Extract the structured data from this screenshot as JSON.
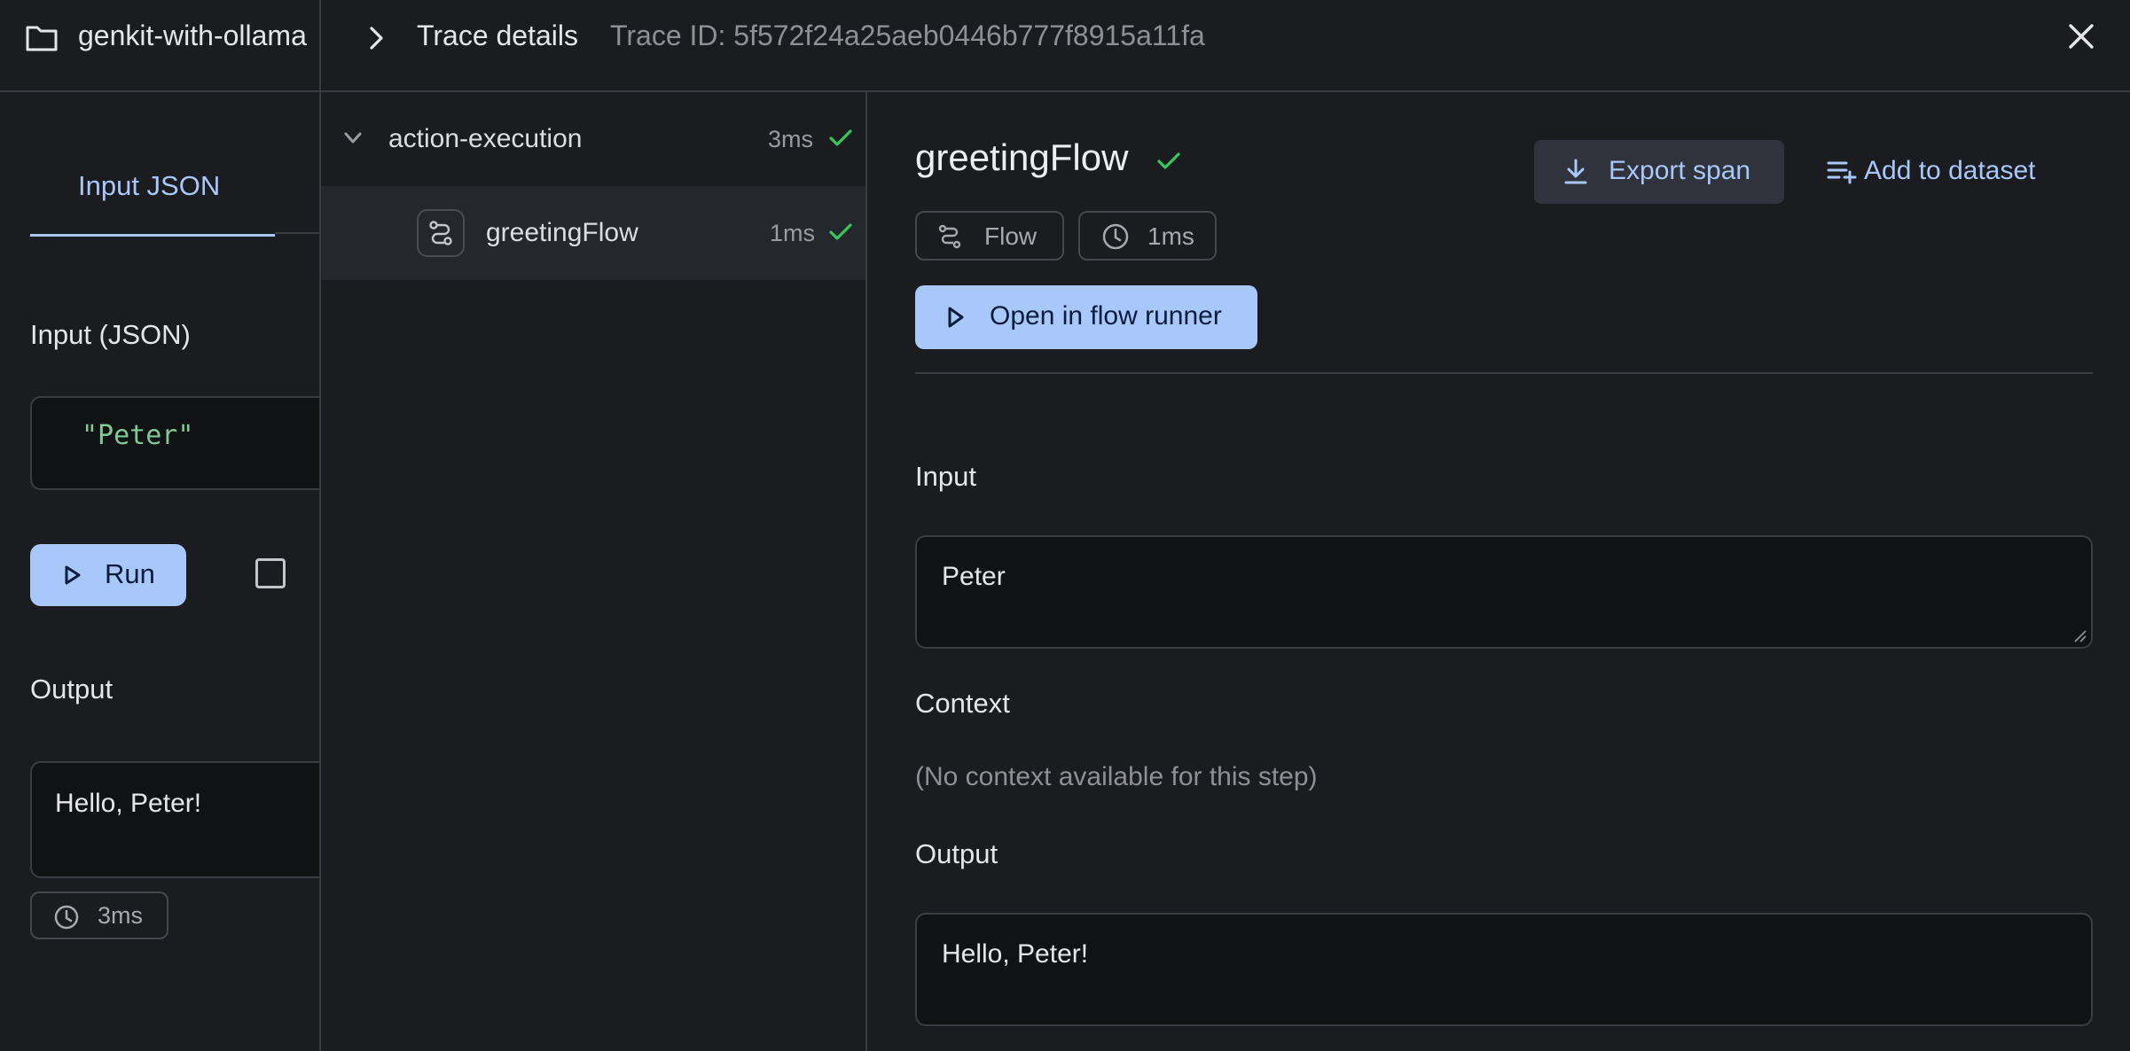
{
  "left_panel": {
    "project_name": "genkit-with-ollama",
    "tab_label": "Input JSON",
    "input_label": "Input (JSON)",
    "input_value": "\"Peter\"",
    "run_label": "Run",
    "output_label": "Output",
    "output_value": "Hello, Peter!",
    "latency": "3ms"
  },
  "drawer": {
    "title": "Trace details",
    "trace_id": "Trace ID: 5f572f24a25aeb0446b777f8915a11fa"
  },
  "tree": {
    "items": [
      {
        "name": "action-execution",
        "duration": "3ms",
        "status": "success"
      },
      {
        "name": "greetingFlow",
        "duration": "1ms",
        "status": "success"
      }
    ]
  },
  "details": {
    "span_name": "greetingFlow",
    "export_label": "Export span",
    "add_dataset_label": "Add to dataset",
    "type_chip": "Flow",
    "duration_chip": "1ms",
    "open_runner_label": "Open in flow runner",
    "input_label": "Input",
    "input_value": "Peter",
    "context_label": "Context",
    "context_empty": "(No context available for this step)",
    "output_label": "Output",
    "output_value": "Hello, Peter!"
  },
  "colors": {
    "accent": "#a8c7fa",
    "success": "#34c759",
    "background": "#1b1c20"
  }
}
